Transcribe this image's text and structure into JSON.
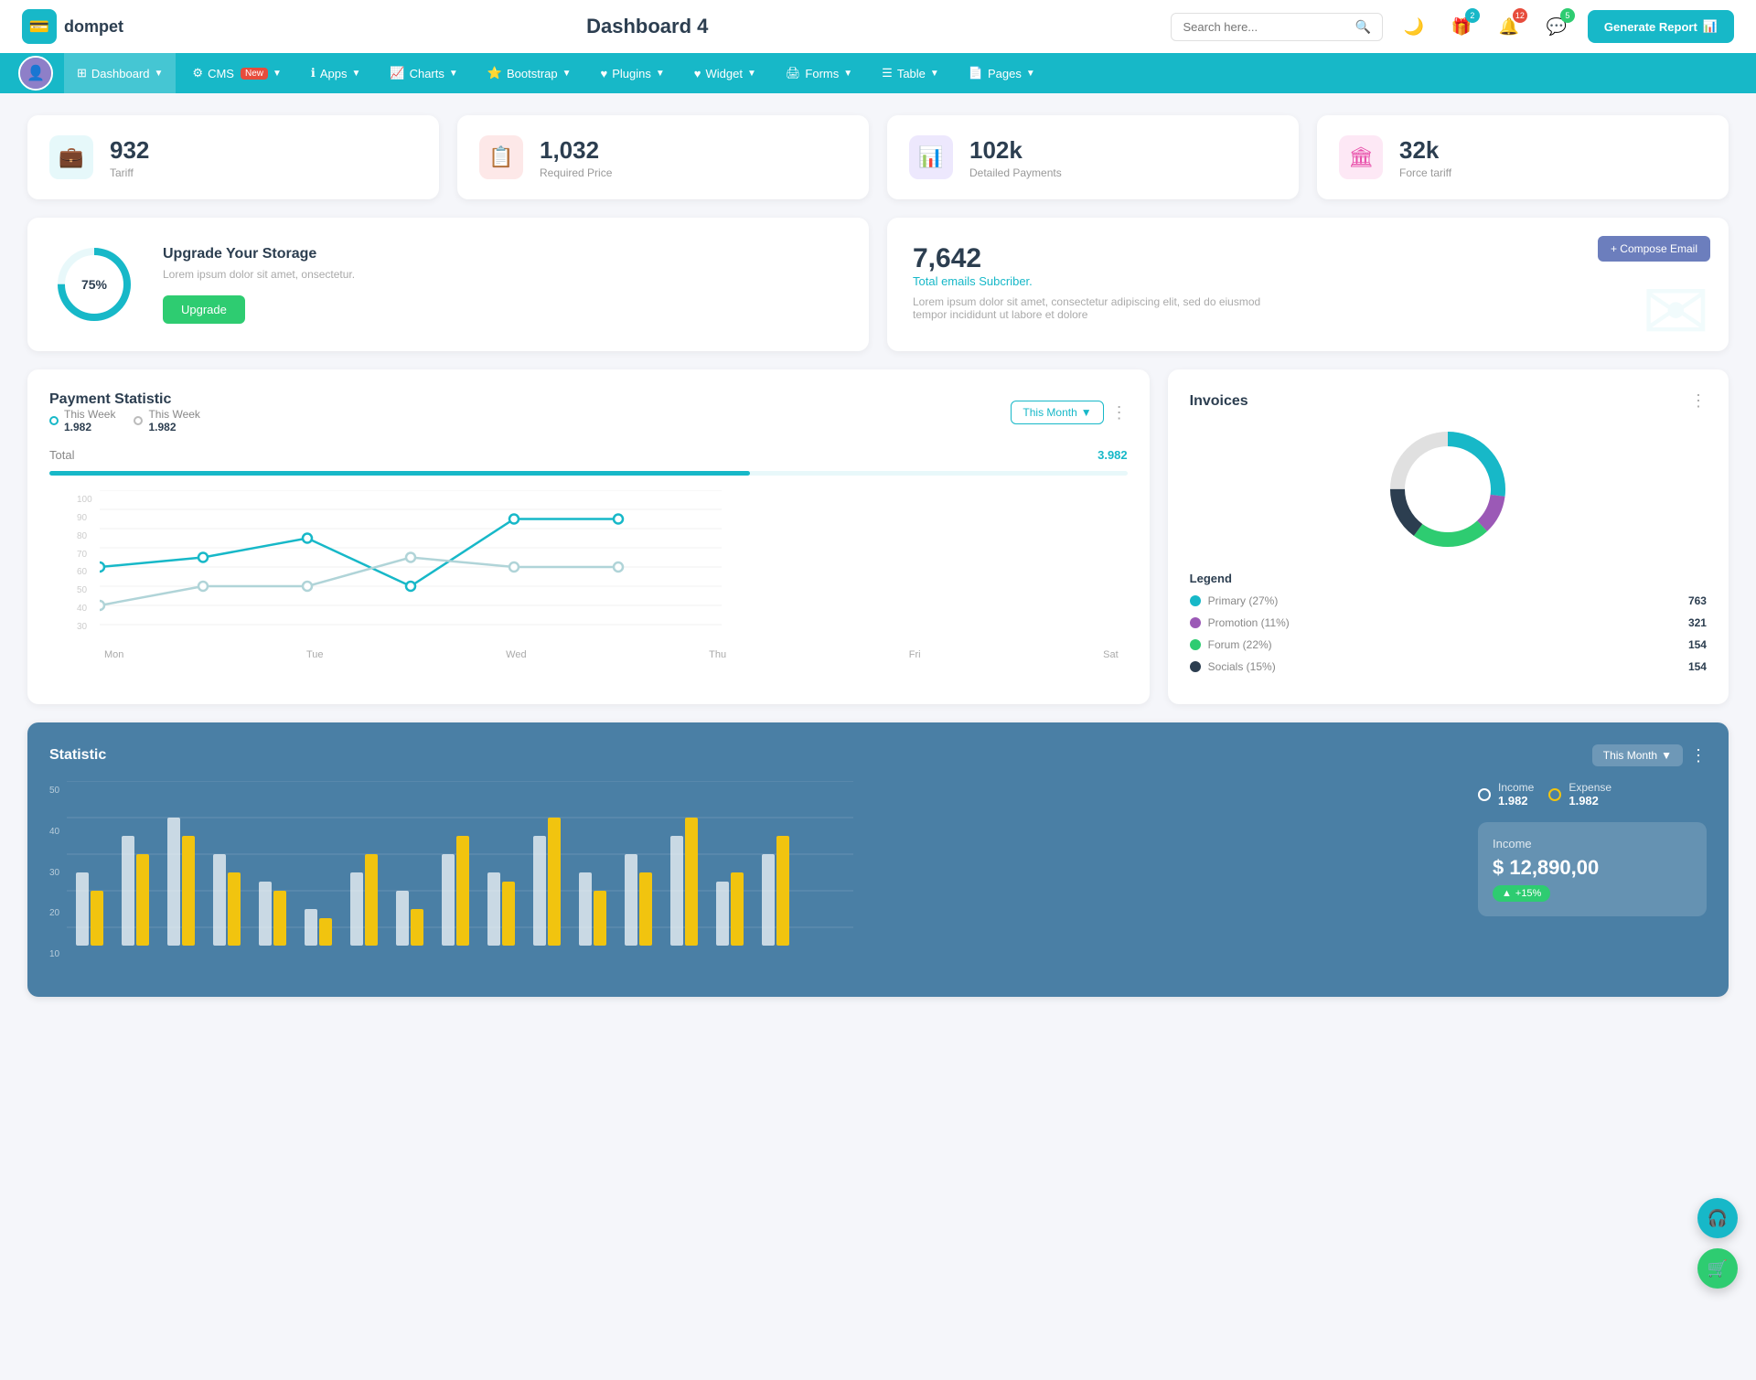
{
  "header": {
    "logo_icon": "💳",
    "logo_text": "dompet",
    "page_title": "Dashboard 4",
    "search_placeholder": "Search here...",
    "generate_report": "Generate Report",
    "icons": {
      "search": "🔍",
      "moon": "🌙",
      "gift": "🎁",
      "bell": "🔔",
      "chat": "💬"
    },
    "badges": {
      "gift": "2",
      "bell": "12",
      "chat": "5"
    }
  },
  "nav": {
    "items": [
      {
        "label": "Dashboard",
        "icon": "⊞",
        "has_arrow": true,
        "active": true
      },
      {
        "label": "CMS",
        "icon": "⚙",
        "has_arrow": true,
        "has_badge": true,
        "badge": "New"
      },
      {
        "label": "Apps",
        "icon": "ℹ",
        "has_arrow": true
      },
      {
        "label": "Charts",
        "icon": "📈",
        "has_arrow": true
      },
      {
        "label": "Bootstrap",
        "icon": "⭐",
        "has_arrow": true
      },
      {
        "label": "Plugins",
        "icon": "♥",
        "has_arrow": true
      },
      {
        "label": "Widget",
        "icon": "♥",
        "has_arrow": true
      },
      {
        "label": "Forms",
        "icon": "🖨",
        "has_arrow": true
      },
      {
        "label": "Table",
        "icon": "☰",
        "has_arrow": true
      },
      {
        "label": "Pages",
        "icon": "📄",
        "has_arrow": true
      }
    ]
  },
  "stat_cards": [
    {
      "value": "932",
      "label": "Tariff",
      "icon_type": "teal",
      "icon": "💼"
    },
    {
      "value": "1,032",
      "label": "Required Price",
      "icon_type": "red",
      "icon": "📋"
    },
    {
      "value": "102k",
      "label": "Detailed Payments",
      "icon_type": "purple",
      "icon": "📊"
    },
    {
      "value": "32k",
      "label": "Force tariff",
      "icon_type": "pink",
      "icon": "🏛"
    }
  ],
  "upgrade": {
    "percent": "75%",
    "title": "Upgrade Your Storage",
    "description": "Lorem ipsum dolor sit amet, onsectetur.",
    "btn_label": "Upgrade"
  },
  "email": {
    "count": "7,642",
    "sub_label": "Total emails Subcriber.",
    "description": "Lorem ipsum dolor sit amet, consectetur adipiscing elit, sed do eiusmod tempor incididunt ut labore et dolore",
    "compose_label": "+ Compose Email"
  },
  "payment": {
    "title": "Payment Statistic",
    "legend": [
      {
        "label": "This Week",
        "value": "1.982",
        "type": "teal"
      },
      {
        "label": "This Week",
        "value": "1.982",
        "type": "gray"
      }
    ],
    "filter": "This Month",
    "total_label": "Total",
    "total_value": "3.982",
    "x_labels": [
      "Mon",
      "Tue",
      "Wed",
      "Thu",
      "Fri",
      "Sat"
    ],
    "y_labels": [
      "100",
      "90",
      "80",
      "70",
      "60",
      "50",
      "40",
      "30"
    ]
  },
  "invoices": {
    "title": "Invoices",
    "legend": [
      {
        "label": "Primary (27%)",
        "value": "763",
        "color": "#17b8c8"
      },
      {
        "label": "Promotion (11%)",
        "value": "321",
        "color": "#9b59b6"
      },
      {
        "label": "Forum (22%)",
        "value": "154",
        "color": "#2ecc71"
      },
      {
        "label": "Socials (15%)",
        "value": "154",
        "color": "#2c3e50"
      }
    ],
    "legend_title": "Legend"
  },
  "statistic": {
    "title": "Statistic",
    "filter": "This Month",
    "y_labels": [
      "50",
      "40",
      "30",
      "20",
      "10"
    ],
    "income_label": "Income",
    "income_value": "1.982",
    "expense_label": "Expense",
    "expense_value": "1.982",
    "income_amount": "$ 12,890,00",
    "income_badge": "+15%",
    "income_section_label": "Income"
  }
}
